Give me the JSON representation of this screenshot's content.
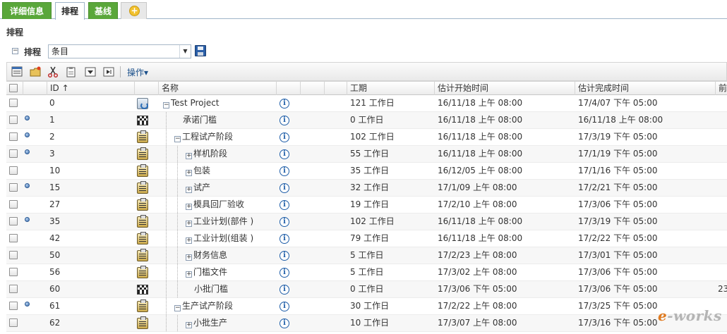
{
  "tabs": [
    {
      "label": "详细信息",
      "active": false
    },
    {
      "label": "排程",
      "active": true
    },
    {
      "label": "基线",
      "active": false
    }
  ],
  "section_label": "排程",
  "schedule": {
    "title": "排程",
    "view_value": "条目"
  },
  "toolbar": {
    "actions_label": "操作▾"
  },
  "columns": {
    "id": "ID ↑",
    "name": "名称",
    "duration": "工期",
    "start": "估计开始时间",
    "finish": "估计完成时间",
    "next": "前"
  },
  "rows": [
    {
      "id": "0",
      "type": "project",
      "level": 0,
      "expanded": true,
      "name": "Test Project",
      "duration": "121 工作日",
      "start": "16/11/18 上午 08:00",
      "finish": "17/4/07 下午 05:00",
      "dot": false,
      "extra": ""
    },
    {
      "id": "1",
      "type": "milestone",
      "level": 1,
      "expanded": null,
      "name": "承诺门槛",
      "duration": "0 工作日",
      "start": "16/11/18 上午 08:00",
      "finish": "16/11/18 上午 08:00",
      "dot": true,
      "extra": ""
    },
    {
      "id": "2",
      "type": "phase",
      "level": 1,
      "expanded": true,
      "name": "工程试产阶段",
      "duration": "102 工作日",
      "start": "16/11/18 上午 08:00",
      "finish": "17/3/19 下午 05:00",
      "dot": true,
      "extra": ""
    },
    {
      "id": "3",
      "type": "phase",
      "level": 2,
      "expanded": false,
      "name": "样机阶段",
      "duration": "55 工作日",
      "start": "16/11/18 上午 08:00",
      "finish": "17/1/19 下午 05:00",
      "dot": true,
      "extra": ""
    },
    {
      "id": "10",
      "type": "phase",
      "level": 2,
      "expanded": false,
      "name": "包装",
      "duration": "35 工作日",
      "start": "16/12/05 上午 08:00",
      "finish": "17/1/16 下午 05:00",
      "dot": false,
      "extra": ""
    },
    {
      "id": "15",
      "type": "phase",
      "level": 2,
      "expanded": false,
      "name": "试产",
      "duration": "32 工作日",
      "start": "17/1/09 上午 08:00",
      "finish": "17/2/21 下午 05:00",
      "dot": true,
      "extra": ""
    },
    {
      "id": "27",
      "type": "phase",
      "level": 2,
      "expanded": false,
      "name": "模具回厂验收",
      "duration": "19 工作日",
      "start": "17/2/10 上午 08:00",
      "finish": "17/3/06 下午 05:00",
      "dot": false,
      "extra": ""
    },
    {
      "id": "35",
      "type": "phase",
      "level": 2,
      "expanded": false,
      "name": "工业计划(部件 )",
      "duration": "102 工作日",
      "start": "16/11/18 上午 08:00",
      "finish": "17/3/19 下午 05:00",
      "dot": true,
      "extra": ""
    },
    {
      "id": "42",
      "type": "phase",
      "level": 2,
      "expanded": false,
      "name": "工业计划(组装 )",
      "duration": "79 工作日",
      "start": "16/11/18 上午 08:00",
      "finish": "17/2/22 下午 05:00",
      "dot": false,
      "extra": ""
    },
    {
      "id": "50",
      "type": "phase",
      "level": 2,
      "expanded": false,
      "name": "财务信息",
      "duration": "5 工作日",
      "start": "17/2/23 上午 08:00",
      "finish": "17/3/01 下午 05:00",
      "dot": false,
      "extra": ""
    },
    {
      "id": "56",
      "type": "phase",
      "level": 2,
      "expanded": false,
      "name": "门槛文件",
      "duration": "5 工作日",
      "start": "17/3/02 上午 08:00",
      "finish": "17/3/06 下午 05:00",
      "dot": false,
      "extra": ""
    },
    {
      "id": "60",
      "type": "milestone",
      "level": 2,
      "expanded": null,
      "name": "小批门槛",
      "duration": "0 工作日",
      "start": "17/3/06 下午 05:00",
      "finish": "17/3/06 下午 05:00",
      "dot": false,
      "extra": "23"
    },
    {
      "id": "61",
      "type": "phase",
      "level": 1,
      "expanded": true,
      "name": "生产试产阶段",
      "duration": "30 工作日",
      "start": "17/2/22 上午 08:00",
      "finish": "17/3/25 下午 05:00",
      "dot": true,
      "extra": ""
    },
    {
      "id": "62",
      "type": "phase",
      "level": 2,
      "expanded": false,
      "name": "小批生产",
      "duration": "10 工作日",
      "start": "17/3/07 上午 08:00",
      "finish": "17/3/16 下午 05:00",
      "dot": false,
      "extra": ""
    }
  ],
  "watermark": {
    "e": "e",
    "rest": "-works"
  },
  "colors": {
    "tab_green": "#5aa73a",
    "link_blue": "#1a4f8a",
    "info_blue": "#1f5ea8"
  }
}
